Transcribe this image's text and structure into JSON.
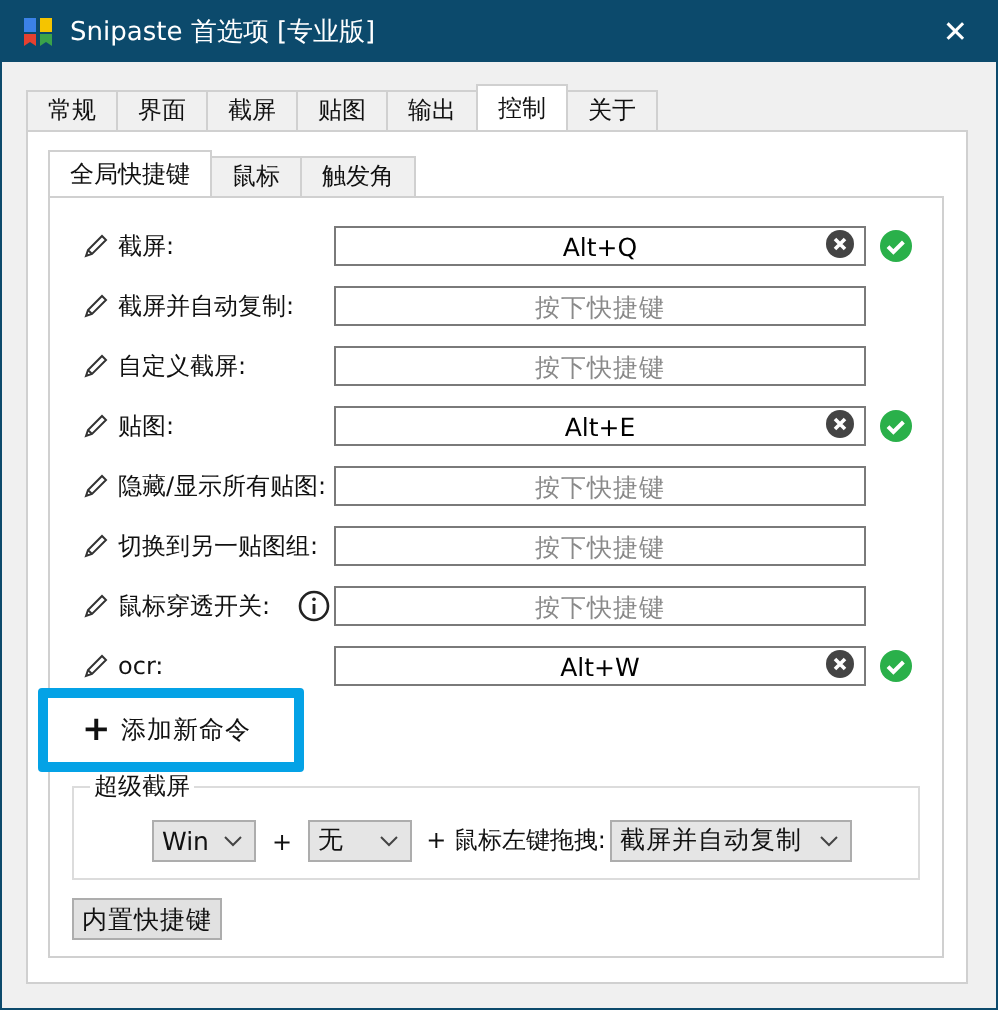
{
  "window": {
    "title": "Snipaste 首选项 [专业版]",
    "close": "✕"
  },
  "tabs": [
    {
      "label": "常规",
      "selected": false
    },
    {
      "label": "界面",
      "selected": false
    },
    {
      "label": "截屏",
      "selected": false
    },
    {
      "label": "贴图",
      "selected": false
    },
    {
      "label": "输出",
      "selected": false
    },
    {
      "label": "控制",
      "selected": true
    },
    {
      "label": "关于",
      "selected": false
    }
  ],
  "subtabs": [
    {
      "label": "全局快捷键",
      "selected": true
    },
    {
      "label": "鼠标",
      "selected": false
    },
    {
      "label": "触发角",
      "selected": false
    }
  ],
  "shortcuts": [
    {
      "label": "截屏:",
      "value": "Alt+Q",
      "valid": true,
      "info": false
    },
    {
      "label": "截屏并自动复制:",
      "placeholder": "按下快捷键",
      "valid": false,
      "info": false
    },
    {
      "label": "自定义截屏:",
      "placeholder": "按下快捷键",
      "valid": false,
      "info": false
    },
    {
      "label": "贴图:",
      "value": "Alt+E",
      "valid": true,
      "info": false
    },
    {
      "label": "隐藏/显示所有贴图:",
      "placeholder": "按下快捷键",
      "valid": false,
      "info": false
    },
    {
      "label": "切换到另一贴图组:",
      "placeholder": "按下快捷键",
      "valid": false,
      "info": false
    },
    {
      "label": "鼠标穿透开关:",
      "placeholder": "按下快捷键",
      "valid": false,
      "info": true
    },
    {
      "label": "ocr:",
      "value": "Alt+W",
      "valid": true,
      "info": false
    }
  ],
  "add_command": {
    "icon": "+",
    "label": "添加新命令"
  },
  "super_screenshot": {
    "title": "超级截屏",
    "modifier_1": "Win",
    "plus_1": "+",
    "modifier_2": "无",
    "plus_2": "+ 鼠标左键拖拽:",
    "action": "截屏并自动复制"
  },
  "builtin_button": "内置快捷键"
}
